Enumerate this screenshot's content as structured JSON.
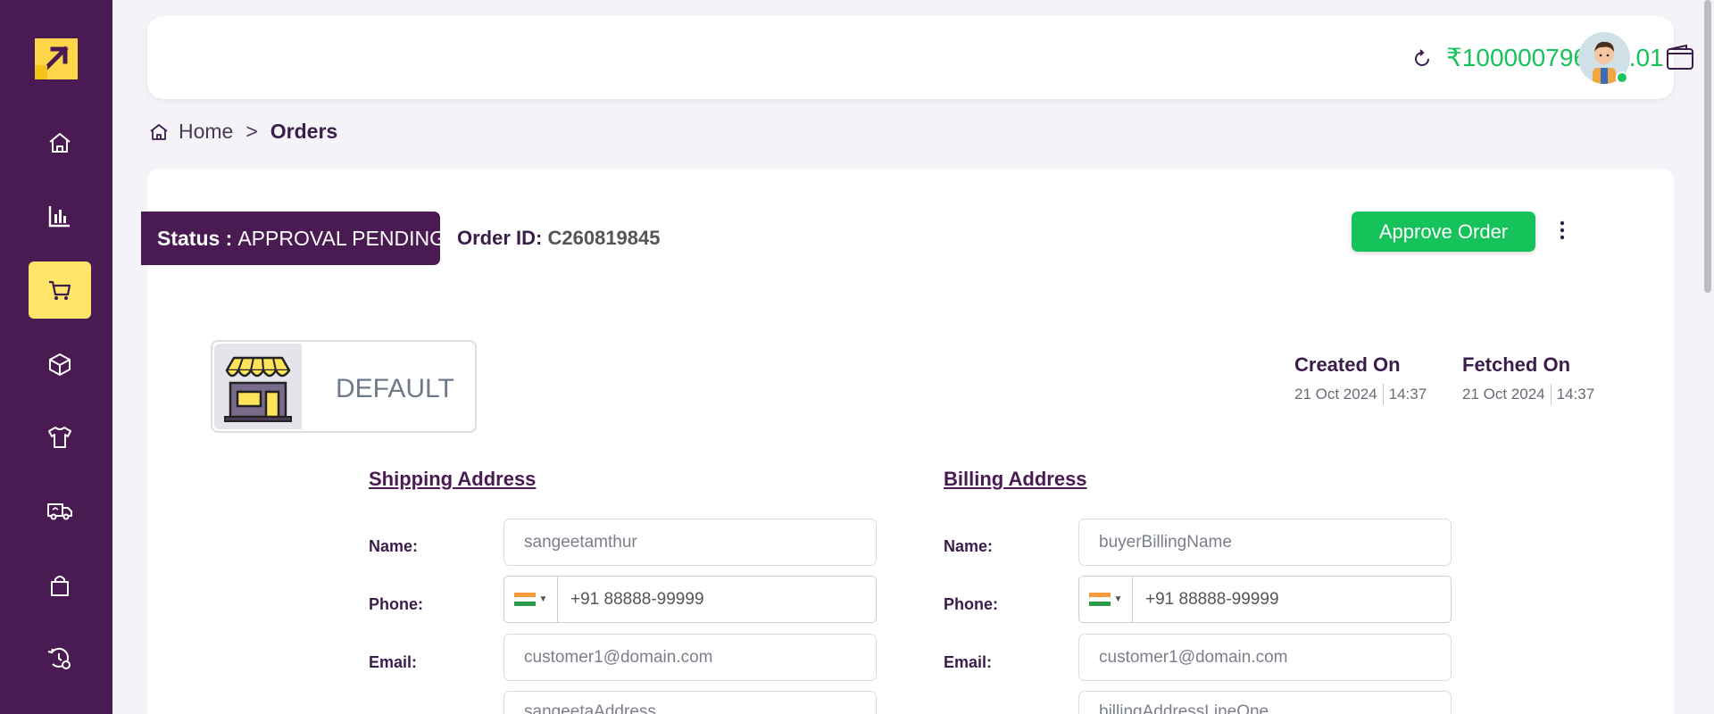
{
  "sidebar": {
    "items": [
      {
        "name": "home",
        "icon": "home-icon"
      },
      {
        "name": "analytics",
        "icon": "bar-chart-icon"
      },
      {
        "name": "orders",
        "icon": "cart-icon",
        "active": true
      },
      {
        "name": "inventory",
        "icon": "box-icon"
      },
      {
        "name": "products",
        "icon": "tshirt-icon"
      },
      {
        "name": "shipping",
        "icon": "delivery-truck-icon"
      },
      {
        "name": "purchases",
        "icon": "shopping-bag-icon"
      },
      {
        "name": "settings",
        "icon": "gear-clock-icon"
      }
    ],
    "bg_color": "#4a1a52",
    "active_color": "#ffe66b"
  },
  "topbar": {
    "balance": "₹100000796951.01",
    "balance_color": "#16c35a"
  },
  "breadcrumb": {
    "home": "Home",
    "separator": ">",
    "current": "Orders"
  },
  "order": {
    "status_label": "Status :",
    "status_value": "APPROVAL PENDING",
    "order_id_label": "Order ID:",
    "order_id_value": "C260819845",
    "approve_label": "Approve Order",
    "store_name": "DEFAULT",
    "created_label": "Created On",
    "created_date": "21 Oct 2024",
    "created_time": "14:37",
    "fetched_label": "Fetched On",
    "fetched_date": "21 Oct 2024",
    "fetched_time": "14:37"
  },
  "shipping": {
    "title": "Shipping Address",
    "name_label": "Name:",
    "name_value": "sangeetamthur",
    "phone_label": "Phone:",
    "phone_value": "+91 88888-99999",
    "email_label": "Email:",
    "email_value": "customer1@domain.com",
    "address_value": "sangeetaAddress"
  },
  "billing": {
    "title": "Billing Address",
    "name_label": "Name:",
    "name_value": "buyerBillingName",
    "phone_label": "Phone:",
    "phone_value": "+91 88888-99999",
    "email_label": "Email:",
    "email_value": "customer1@domain.com",
    "address_value": "billingAddressLineOne"
  }
}
